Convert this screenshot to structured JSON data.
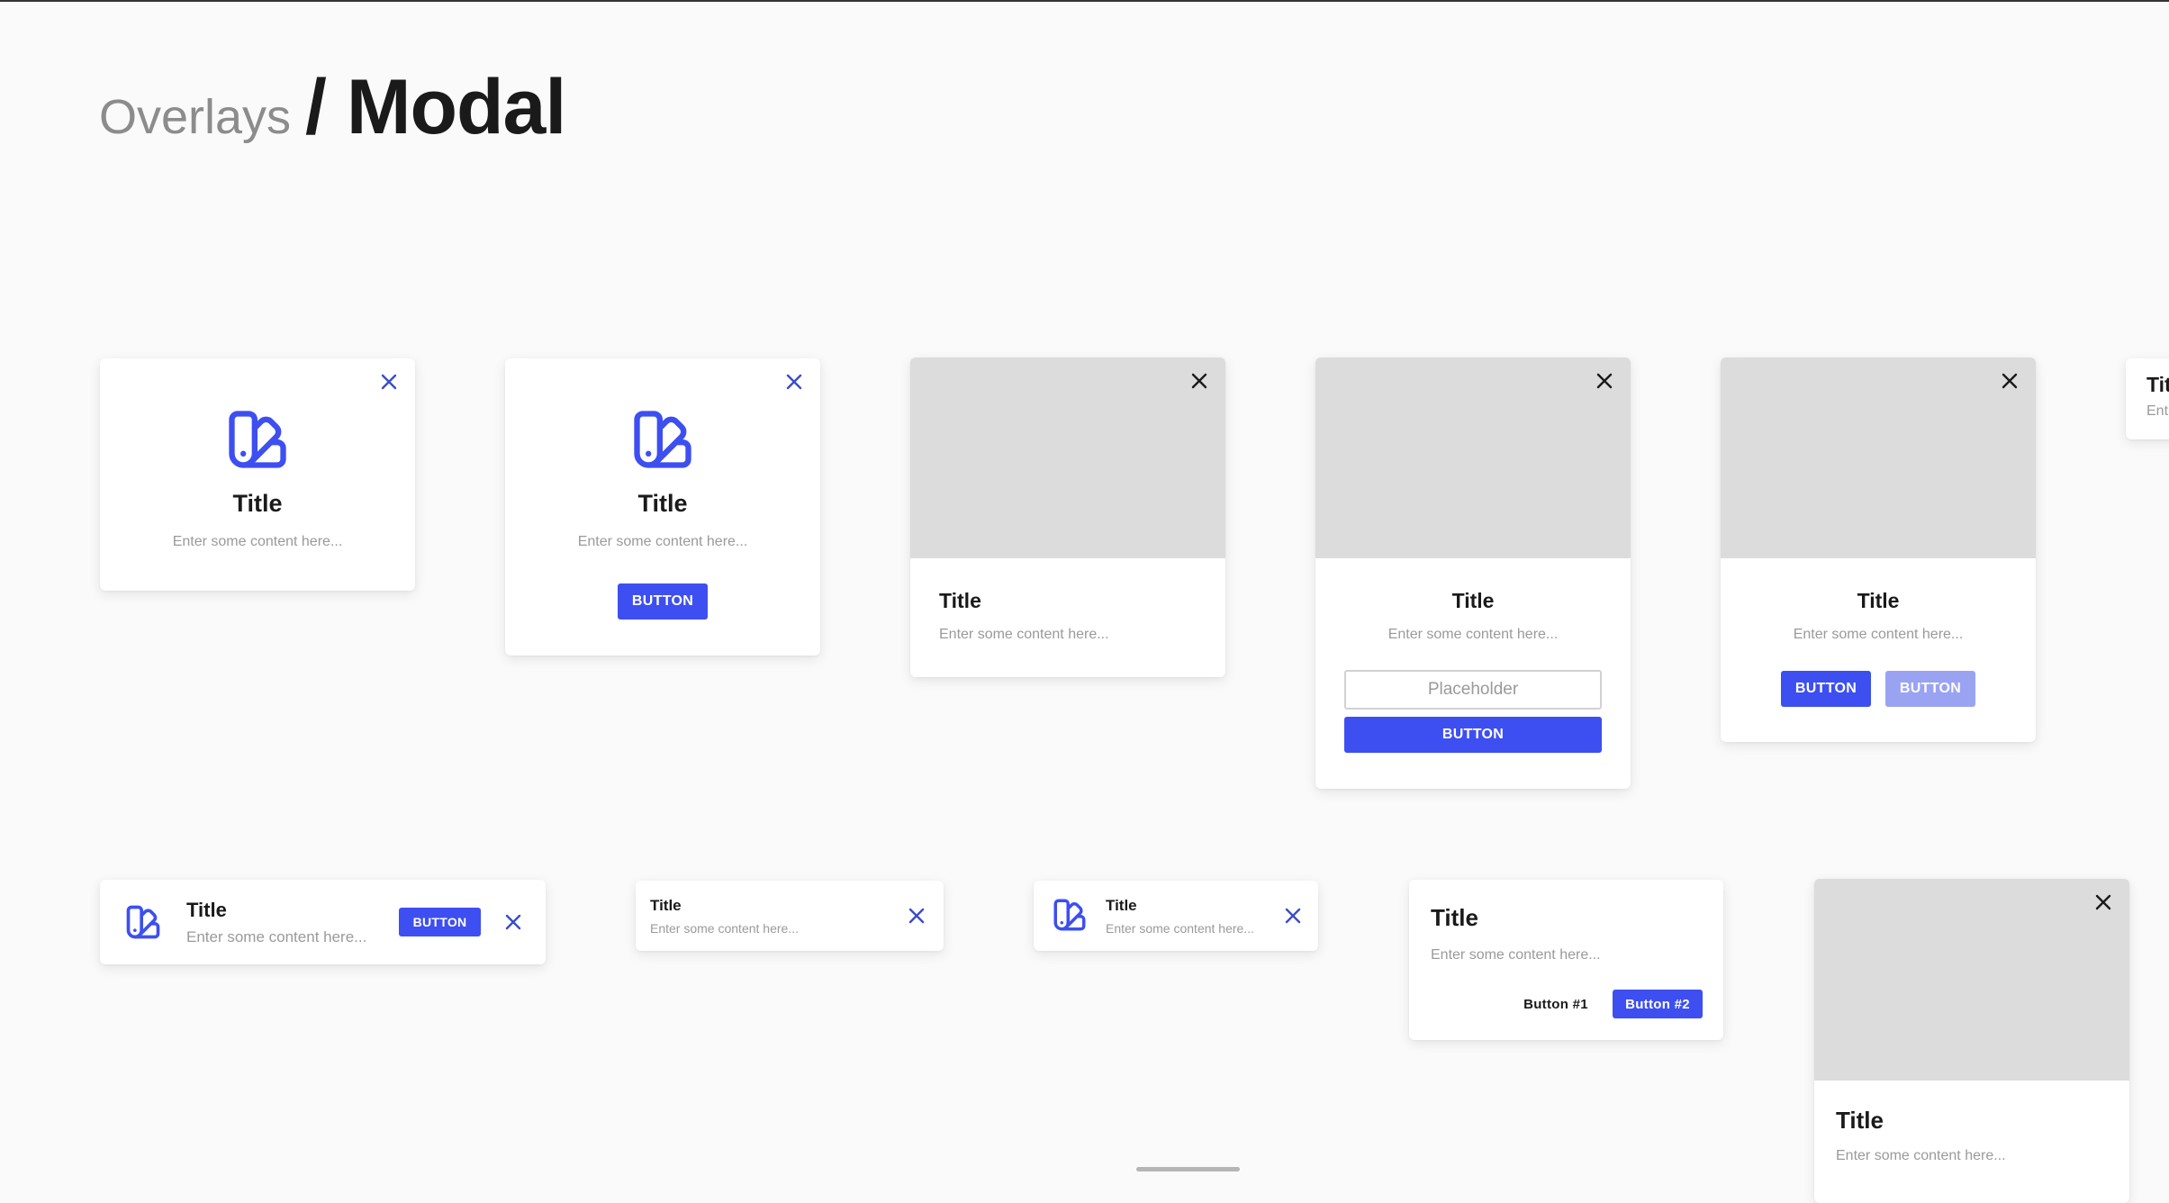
{
  "header": {
    "breadcrumb": "Overlays",
    "title": "/ Modal"
  },
  "modal": {
    "title": "Title",
    "content": "Enter some content here...",
    "button_label": "BUTTON",
    "input_placeholder": "Placeholder",
    "button1_label": "Button #1",
    "button2_label": "Button #2",
    "partial_title": "Tit",
    "partial_content": "Ent"
  },
  "colors": {
    "accent": "#3d4ff0",
    "accent_disabled": "#9aa3f2",
    "image_placeholder": "#dcdcdc",
    "background": "#fafafa"
  },
  "icons": {
    "brand": "swatch-book-icon",
    "close": "close-icon"
  }
}
